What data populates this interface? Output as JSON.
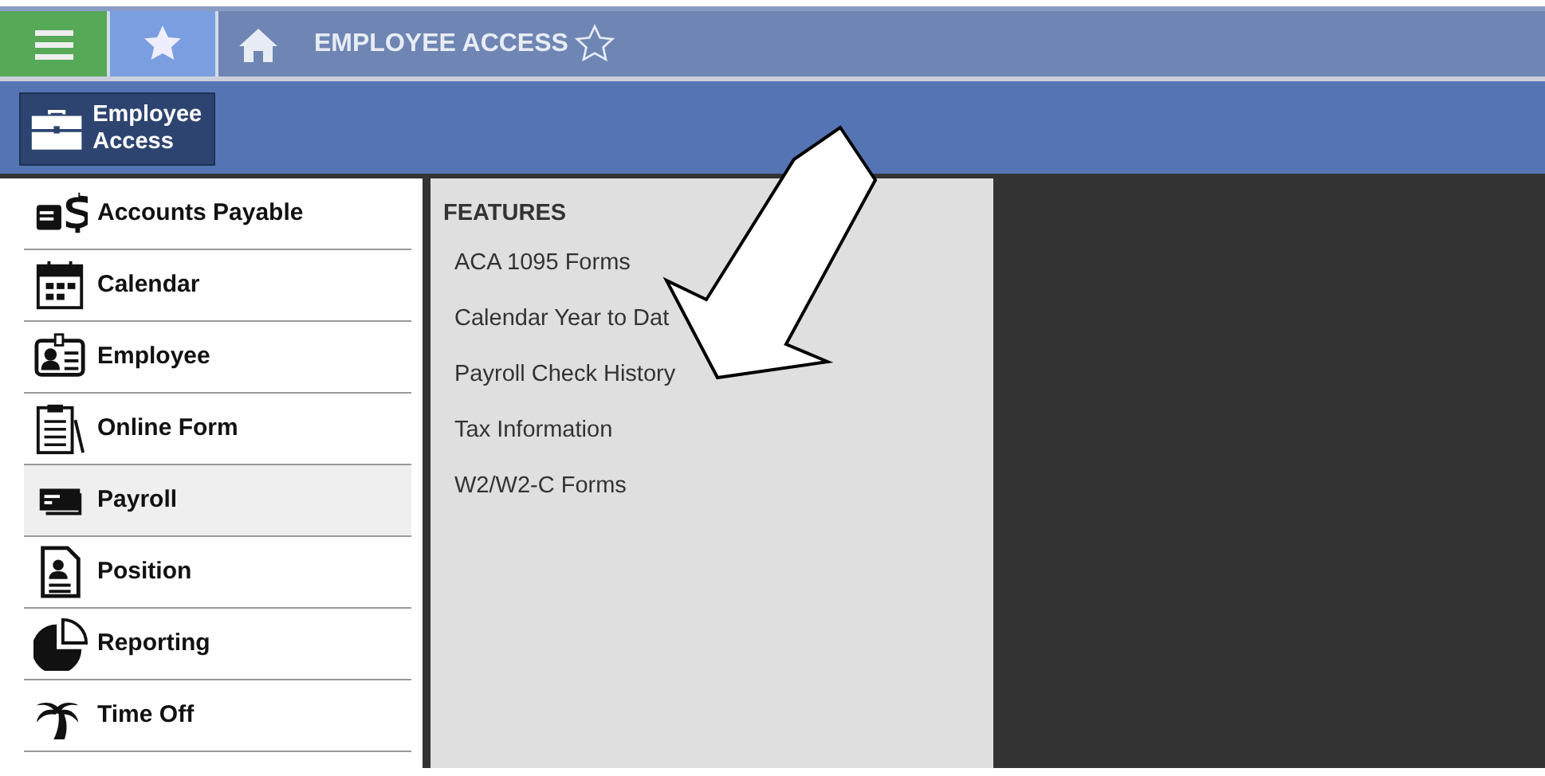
{
  "topbar": {
    "title": "EMPLOYEE ACCESS"
  },
  "module_tile": {
    "label": "Employee Access"
  },
  "sidebar": {
    "items": [
      {
        "label": "Accounts Payable",
        "selected": false
      },
      {
        "label": "Calendar",
        "selected": false
      },
      {
        "label": "Employee",
        "selected": false
      },
      {
        "label": "Online Form",
        "selected": false
      },
      {
        "label": "Payroll",
        "selected": true
      },
      {
        "label": "Position",
        "selected": false
      },
      {
        "label": "Reporting",
        "selected": false
      },
      {
        "label": "Time Off",
        "selected": false
      }
    ]
  },
  "features": {
    "heading": "FEATURES",
    "items": [
      "ACA 1095 Forms",
      "Calendar Year to Dat",
      "Payroll Check History",
      "Tax Information",
      "W2/W2-C Forms"
    ]
  }
}
